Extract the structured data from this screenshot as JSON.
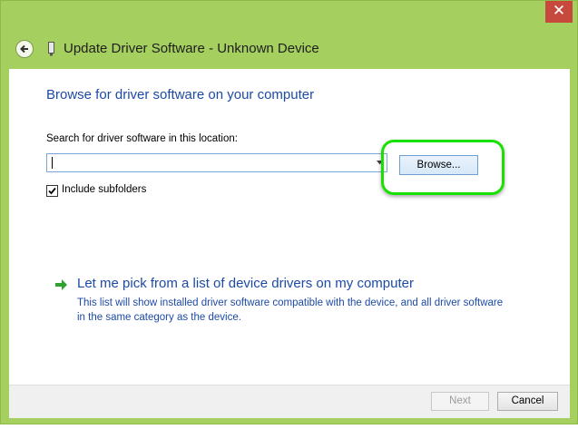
{
  "window": {
    "title": "Update Driver Software - Unknown Device",
    "close_glyph": "✕",
    "accent_color": "#a5cf5f"
  },
  "main": {
    "heading": "Browse for driver software on your computer",
    "search_label": "Search for driver software in this location:",
    "path_value": "",
    "browse_label": "Browse...",
    "include_subfolders_label": "Include subfolders",
    "include_subfolders_checked": true,
    "pick_link": "Let me pick from a list of device drivers on my computer",
    "pick_description": "This list will show installed driver software compatible with the device, and all driver software in the same category as the device."
  },
  "footer": {
    "next_label": "Next",
    "next_enabled": false,
    "cancel_label": "Cancel"
  },
  "icons": {
    "back": "back-arrow-icon",
    "device": "device-icon",
    "pick_arrow": "green-arrow-icon",
    "checkbox_mark": "checkmark-icon"
  }
}
